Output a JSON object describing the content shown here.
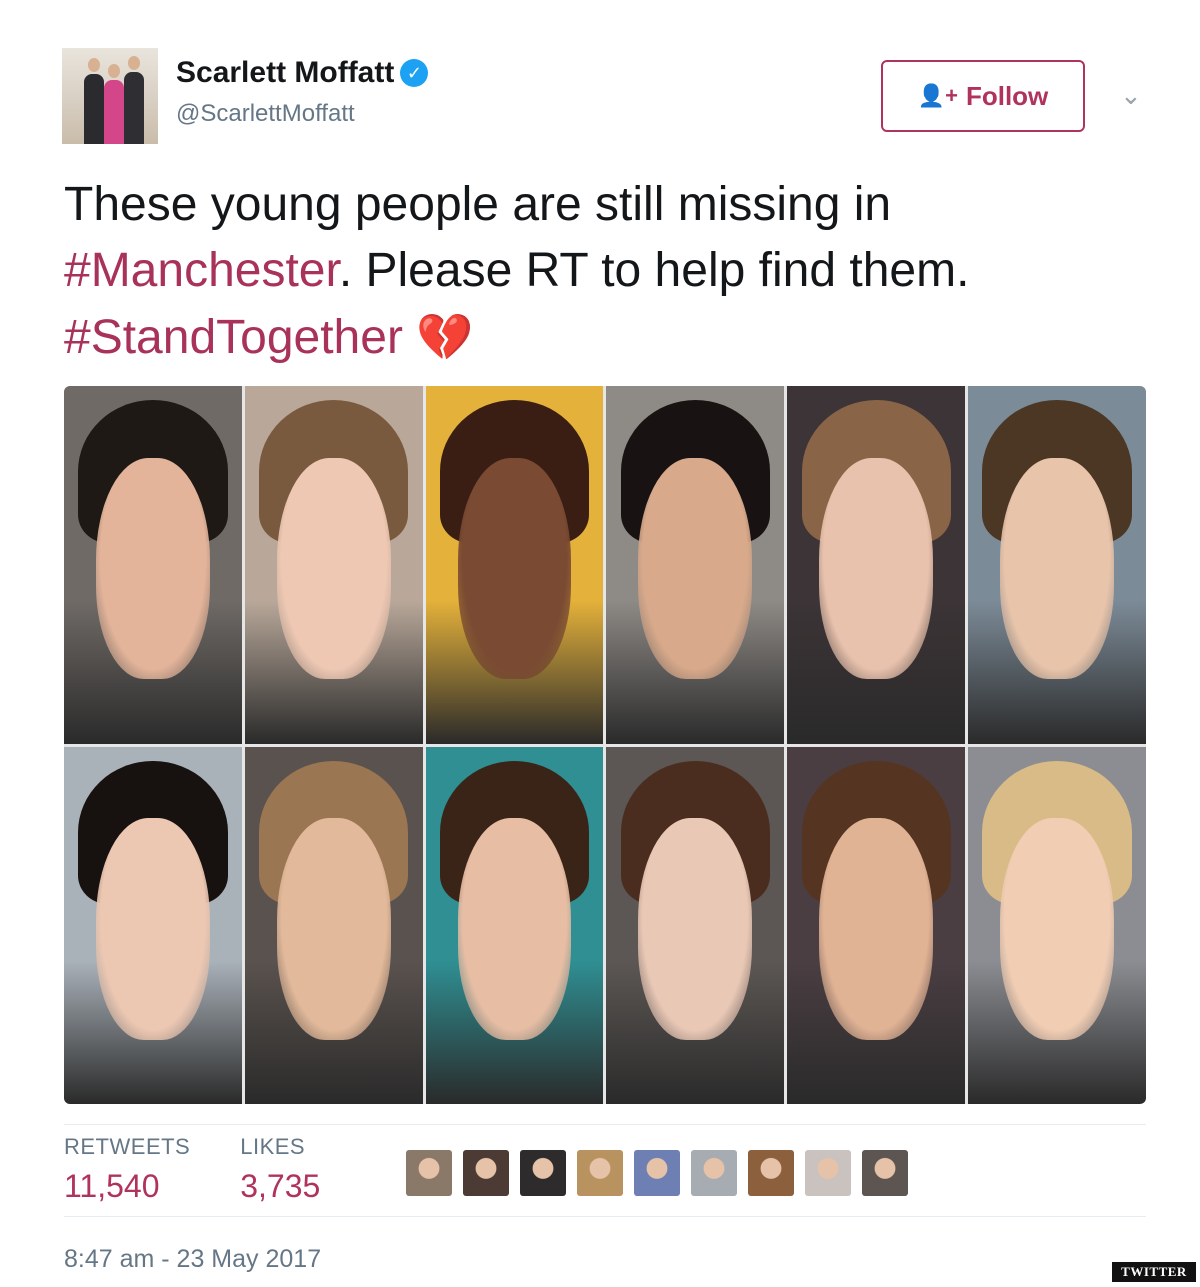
{
  "author": {
    "name": "Scarlett Moffatt",
    "handle": "@ScarlettMoffatt",
    "verified_icon": "verified-badge-icon"
  },
  "follow_button": {
    "label": "Follow",
    "icon": "add-user-icon"
  },
  "menu_icon": "chevron-down-icon",
  "tweet": {
    "line1": "These young people are still missing in",
    "hashtag_manchester": "#Manchester",
    "line2_rest": ". Please RT to help find them.",
    "hashtag_stand": "#StandTogether",
    "emoji": "💔"
  },
  "photos": [
    {
      "skin": "#e3b49a",
      "hair": "#1e1914",
      "bg": "#6f6a66"
    },
    {
      "skin": "#eec8b3",
      "hair": "#7a5a3f",
      "bg": "#b9a89a"
    },
    {
      "skin": "#7a4a33",
      "hair": "#3a1e14",
      "bg": "#e4b13a"
    },
    {
      "skin": "#d8a98b",
      "hair": "#181312",
      "bg": "#8e8a86"
    },
    {
      "skin": "#e9c2ad",
      "hair": "#8a6446",
      "bg": "#3c3436"
    },
    {
      "skin": "#e8c4aa",
      "hair": "#4b3724",
      "bg": "#7c8b98"
    },
    {
      "skin": "#ecc7b2",
      "hair": "#17110f",
      "bg": "#a9b1b9"
    },
    {
      "skin": "#e2b99a",
      "hair": "#9a7652",
      "bg": "#5a524e"
    },
    {
      "skin": "#e7bda4",
      "hair": "#3a2417",
      "bg": "#2f8f93"
    },
    {
      "skin": "#eac8b6",
      "hair": "#4a2d1e",
      "bg": "#5c5754"
    },
    {
      "skin": "#e1b395",
      "hair": "#553521",
      "bg": "#4a3e42"
    },
    {
      "skin": "#f1cdb4",
      "hair": "#d8bb86",
      "bg": "#8b8d92"
    }
  ],
  "stats": {
    "retweets_label": "RETWEETS",
    "retweets_value": "11,540",
    "likes_label": "LIKES",
    "likes_value": "3,735"
  },
  "likers": [
    "#8a7868",
    "#4b3b34",
    "#2d2b2b",
    "#b9935f",
    "#6e7fb3",
    "#a7acb2",
    "#8c5f3d",
    "#c9c2bf",
    "#5c5552"
  ],
  "timestamp": "8:47 am - 23 May 2017",
  "source_badge": "TWITTER",
  "colors": {
    "accent": "#b0335e",
    "hashtag": "#a8325a",
    "muted": "#657786",
    "verified": "#1da1f2"
  }
}
